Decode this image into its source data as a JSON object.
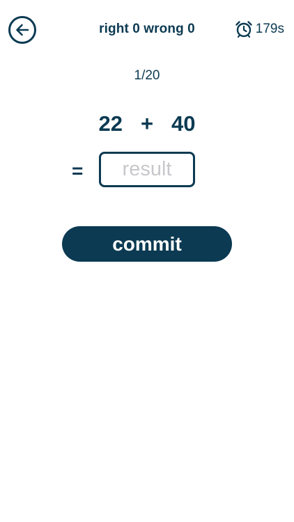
{
  "header": {
    "back_icon": "arrow-left-icon",
    "score_text": "right 0 wrong 0",
    "timer_icon": "alarm-clock-icon",
    "timer_text": "179s"
  },
  "quiz": {
    "progress": "1/20",
    "operand_a": "22",
    "operator": "+",
    "operand_b": "40",
    "equals": "=",
    "result_value": "",
    "result_placeholder": "result",
    "commit_label": "commit"
  },
  "colors": {
    "primary": "#0b3a52",
    "placeholder": "#c8c8cc",
    "background": "#ffffff"
  }
}
